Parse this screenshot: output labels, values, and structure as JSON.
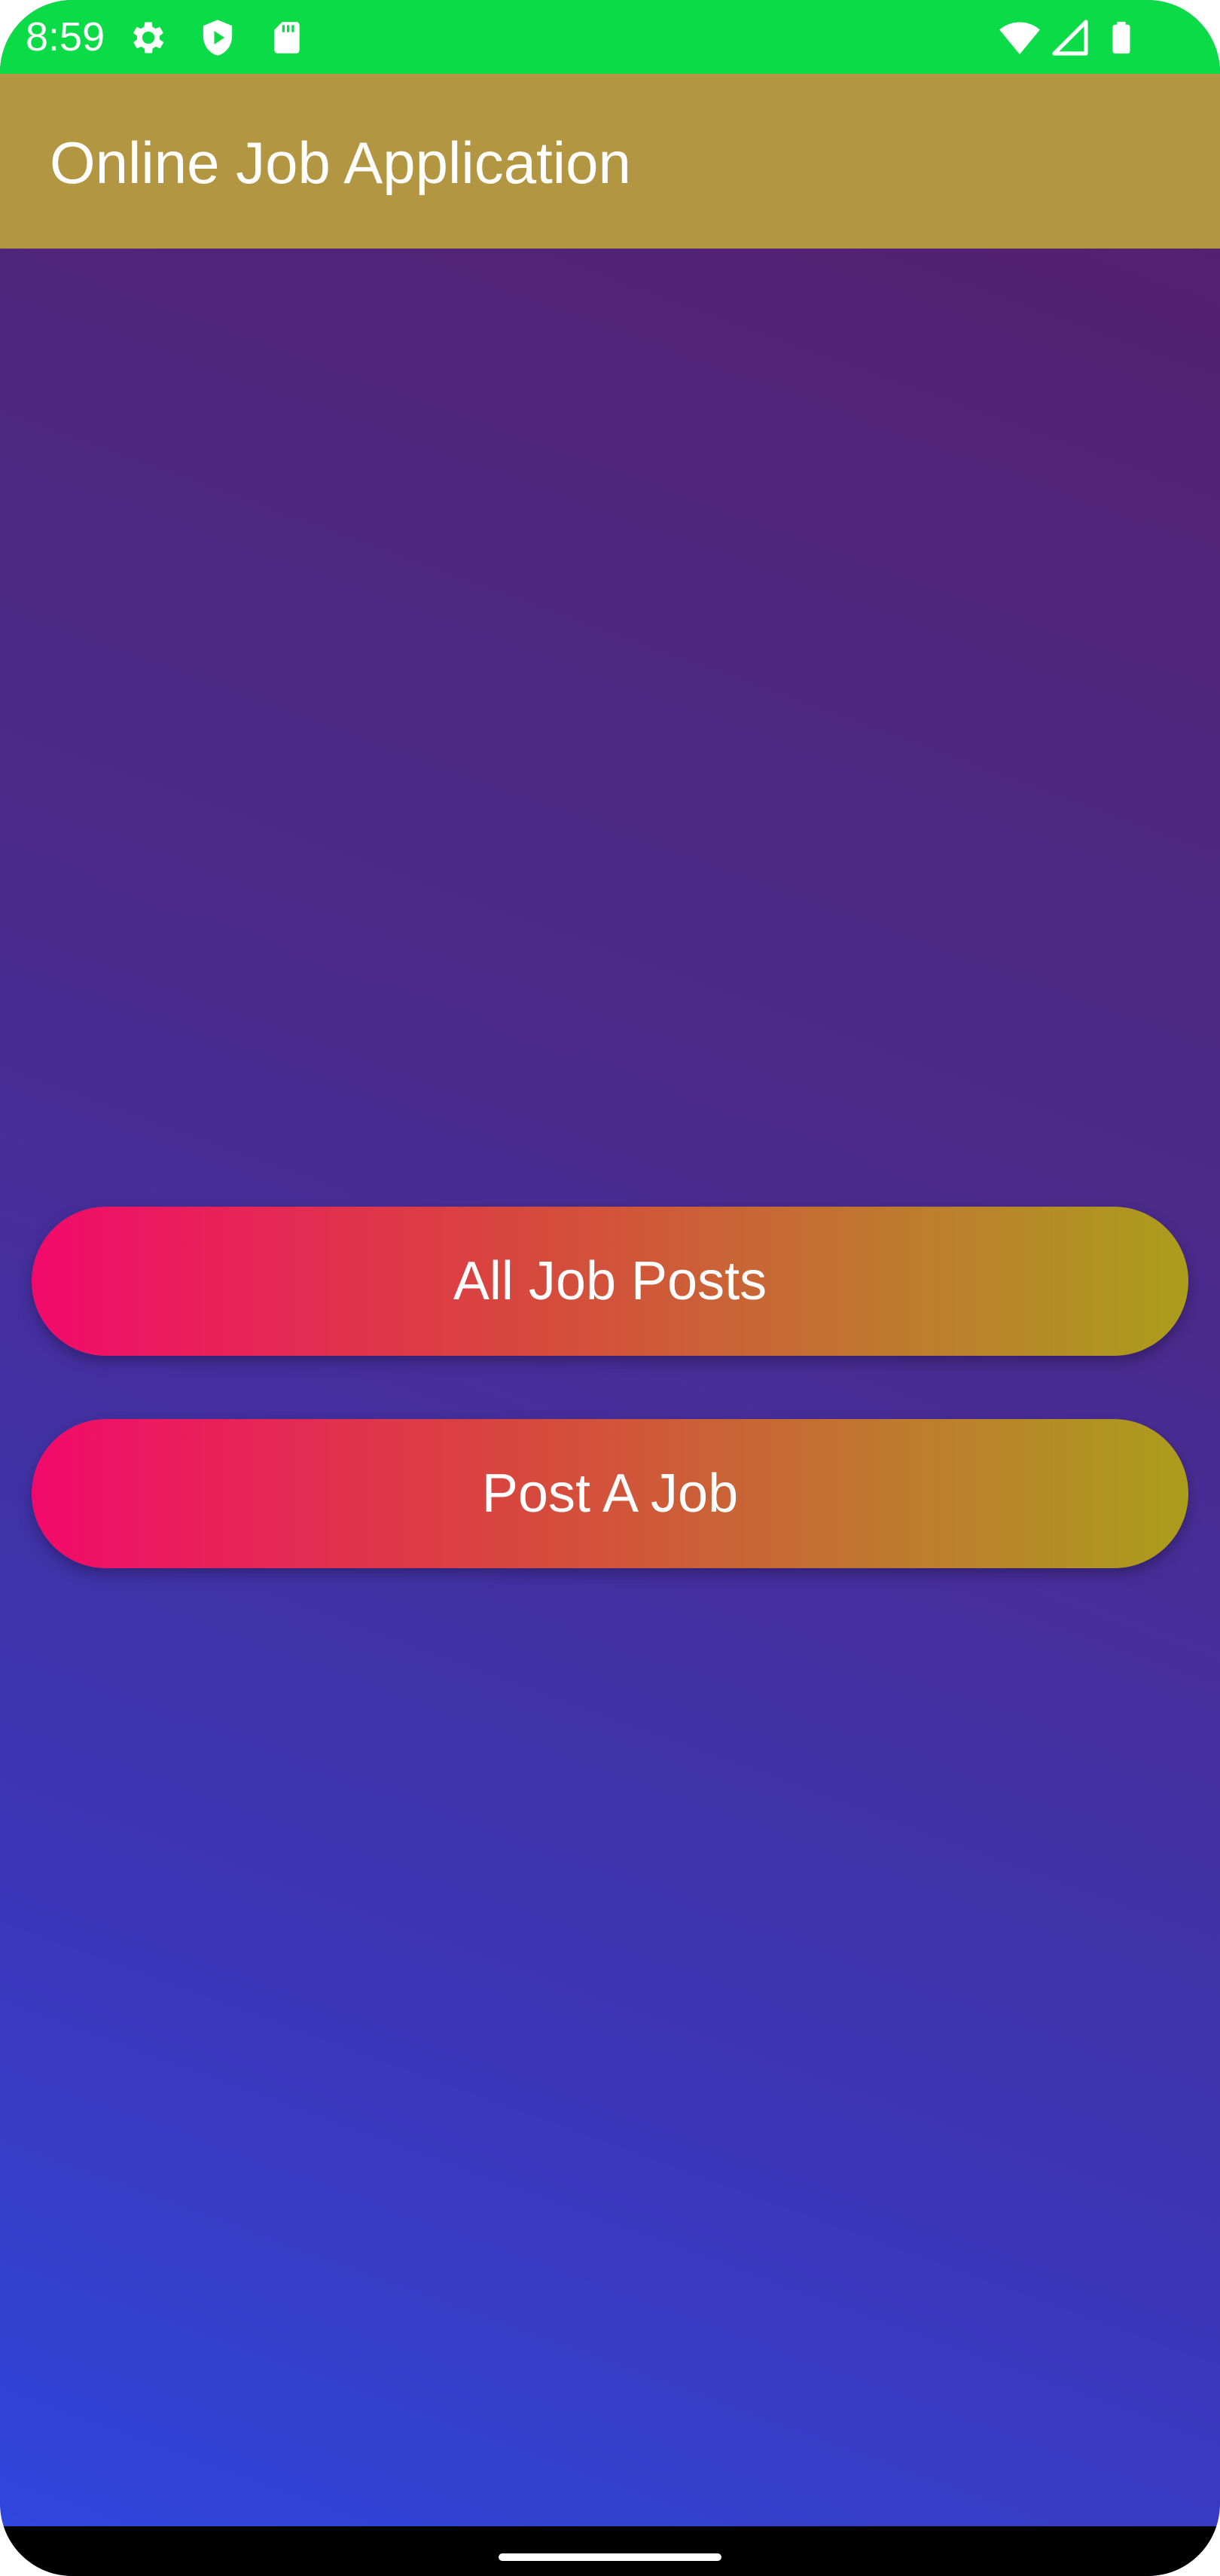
{
  "status_bar": {
    "time": "8:59",
    "background_color": "#0adb46",
    "left_icons": [
      "settings-icon",
      "shield-play-icon",
      "sd-card-icon"
    ],
    "right_icons": [
      "wifi-icon",
      "signal-icon",
      "battery-icon"
    ]
  },
  "app_bar": {
    "title": "Online Job Application",
    "background_color": "#b39641"
  },
  "main": {
    "buttons": [
      {
        "label": "All Job Posts"
      },
      {
        "label": "Post A Job"
      }
    ]
  },
  "colors": {
    "background_gradient": [
      "#551f68",
      "#2f47df"
    ],
    "button_gradient": [
      "#f20a6b",
      "#ab9d1c"
    ]
  }
}
